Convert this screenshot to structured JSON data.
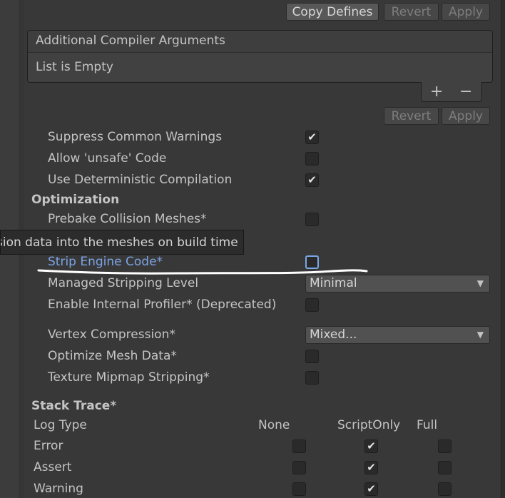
{
  "top_buttons": {
    "copy_defines": "Copy Defines",
    "revert": "Revert",
    "apply": "Apply"
  },
  "compiler_args": {
    "header": "Additional Compiler Arguments",
    "empty_text": "List is Empty",
    "add": "+",
    "remove": "−"
  },
  "mid_buttons": {
    "revert": "Revert",
    "apply": "Apply"
  },
  "settings": {
    "suppress_warnings": {
      "label": "Suppress Common Warnings",
      "checked": true
    },
    "allow_unsafe": {
      "label": "Allow 'unsafe' Code",
      "checked": false
    },
    "deterministic": {
      "label": "Use Deterministic Compilation",
      "checked": true
    }
  },
  "optimization": {
    "title": "Optimization",
    "prebake": {
      "label": "Prebake Collision Meshes*",
      "checked": false
    },
    "tooltip": "sion data into the meshes on build time",
    "strip_engine": {
      "label": "Strip Engine Code*",
      "checked": false
    },
    "managed_stripping": {
      "label": "Managed Stripping Level",
      "value": "Minimal"
    },
    "internal_profiler": {
      "label": "Enable Internal Profiler* (Deprecated)",
      "checked": false
    },
    "vertex_compression": {
      "label": "Vertex Compression*",
      "value": "Mixed..."
    },
    "optimize_mesh": {
      "label": "Optimize Mesh Data*",
      "checked": false
    },
    "texture_mipmap": {
      "label": "Texture Mipmap Stripping*",
      "checked": false
    }
  },
  "stack_trace": {
    "title": "Stack Trace*",
    "columns": {
      "log_type": "Log Type",
      "none": "None",
      "script_only": "ScriptOnly",
      "full": "Full"
    },
    "rows": [
      {
        "label": "Error",
        "none": false,
        "script_only": true,
        "full": false
      },
      {
        "label": "Assert",
        "none": false,
        "script_only": true,
        "full": false
      },
      {
        "label": "Warning",
        "none": false,
        "script_only": true,
        "full": false
      }
    ]
  },
  "icons": {
    "check": "✔",
    "dropdown_arrow": "▼"
  }
}
